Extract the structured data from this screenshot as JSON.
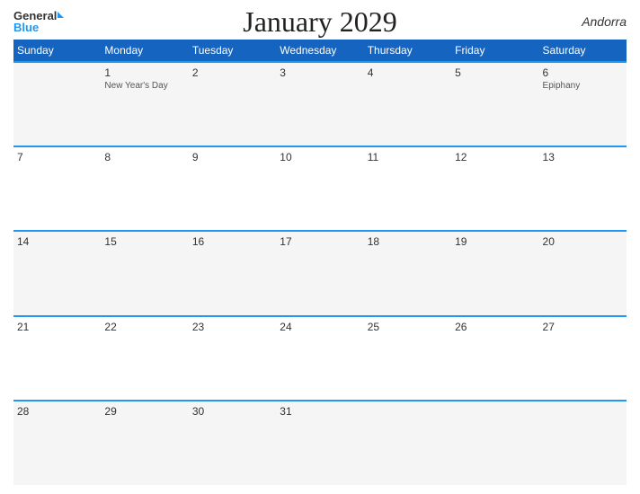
{
  "header": {
    "title": "January 2029",
    "country": "Andorra",
    "logo_general": "General",
    "logo_blue": "Blue"
  },
  "weekdays": [
    "Sunday",
    "Monday",
    "Tuesday",
    "Wednesday",
    "Thursday",
    "Friday",
    "Saturday"
  ],
  "weeks": [
    [
      {
        "day": "",
        "holiday": ""
      },
      {
        "day": "1",
        "holiday": "New Year's Day"
      },
      {
        "day": "2",
        "holiday": ""
      },
      {
        "day": "3",
        "holiday": ""
      },
      {
        "day": "4",
        "holiday": ""
      },
      {
        "day": "5",
        "holiday": ""
      },
      {
        "day": "6",
        "holiday": "Epiphany"
      }
    ],
    [
      {
        "day": "7",
        "holiday": ""
      },
      {
        "day": "8",
        "holiday": ""
      },
      {
        "day": "9",
        "holiday": ""
      },
      {
        "day": "10",
        "holiday": ""
      },
      {
        "day": "11",
        "holiday": ""
      },
      {
        "day": "12",
        "holiday": ""
      },
      {
        "day": "13",
        "holiday": ""
      }
    ],
    [
      {
        "day": "14",
        "holiday": ""
      },
      {
        "day": "15",
        "holiday": ""
      },
      {
        "day": "16",
        "holiday": ""
      },
      {
        "day": "17",
        "holiday": ""
      },
      {
        "day": "18",
        "holiday": ""
      },
      {
        "day": "19",
        "holiday": ""
      },
      {
        "day": "20",
        "holiday": ""
      }
    ],
    [
      {
        "day": "21",
        "holiday": ""
      },
      {
        "day": "22",
        "holiday": ""
      },
      {
        "day": "23",
        "holiday": ""
      },
      {
        "day": "24",
        "holiday": ""
      },
      {
        "day": "25",
        "holiday": ""
      },
      {
        "day": "26",
        "holiday": ""
      },
      {
        "day": "27",
        "holiday": ""
      }
    ],
    [
      {
        "day": "28",
        "holiday": ""
      },
      {
        "day": "29",
        "holiday": ""
      },
      {
        "day": "30",
        "holiday": ""
      },
      {
        "day": "31",
        "holiday": ""
      },
      {
        "day": "",
        "holiday": ""
      },
      {
        "day": "",
        "holiday": ""
      },
      {
        "day": "",
        "holiday": ""
      }
    ]
  ]
}
